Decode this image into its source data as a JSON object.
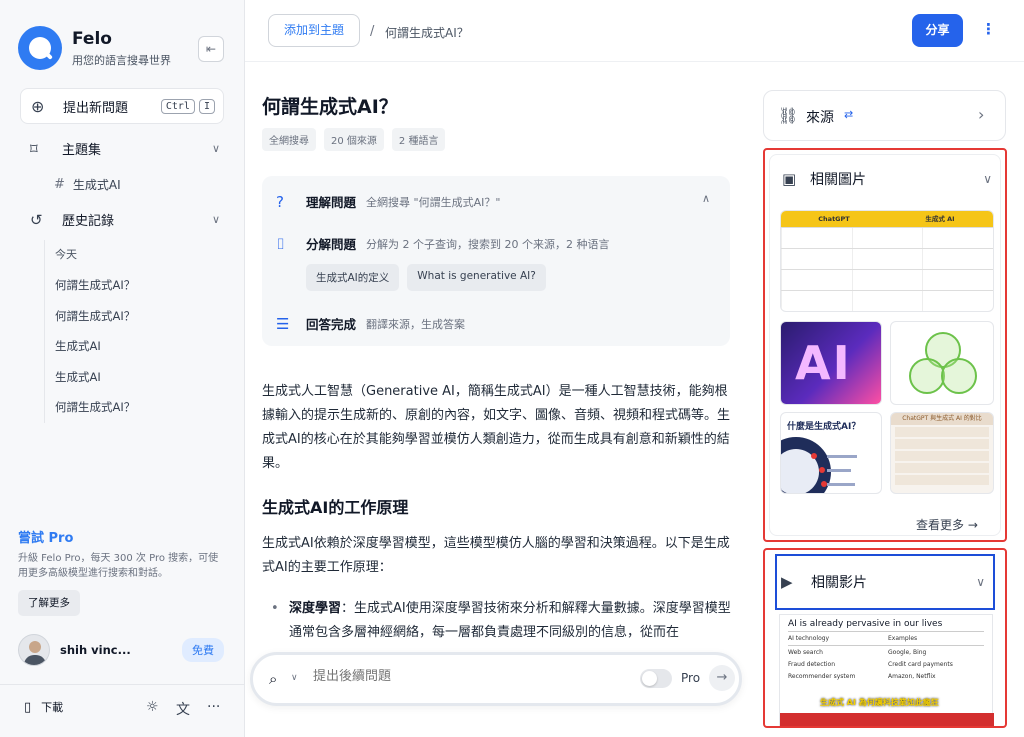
{
  "sidebar": {
    "brand_name": "Felo",
    "brand_sub": "用您的語言搜尋世界",
    "collapse_icon": "⇤",
    "new_question": {
      "label": "提出新問題",
      "kbd1": "Ctrl",
      "kbd2": "I"
    },
    "topics": {
      "label": "主題集",
      "item": "生成式AI"
    },
    "history": {
      "label": "歷史記錄",
      "group": "今天",
      "items": [
        "何謂生成式AI？",
        "何謂生成式AI？",
        "生成式AI",
        "生成式AI",
        "何謂生成式AI？"
      ]
    },
    "pro": {
      "title": "嘗試 Pro",
      "desc": "升級 Felo Pro，每天 300 次 Pro 搜索，可使用更多高級模型進行搜索和對話。",
      "learn_more": "了解更多"
    },
    "user": {
      "name": "shih vinc...",
      "badge": "免費"
    },
    "download": "下載"
  },
  "header": {
    "add_topic": "添加到主題",
    "separator": "/",
    "breadcrumb": "何謂生成式AI？",
    "share": "分享"
  },
  "main": {
    "title": "何謂生成式AI？",
    "tags": [
      "全網搜尋",
      "20 個來源",
      "2 種語言"
    ],
    "steps": [
      {
        "title": "理解問題",
        "desc": "全網搜尋 \"何謂生成式AI？\""
      },
      {
        "title": "分解問題",
        "desc": "分解为 2 个子查询，搜索到 20 个来源，2 种语言"
      },
      {
        "title": "回答完成",
        "desc": "翻譯來源，生成答案"
      }
    ],
    "chips": [
      "生成式AI的定义",
      "What is generative AI?"
    ],
    "intro": "生成式人工智慧（Generative AI，簡稱生成式AI）是一種人工智慧技術，能夠根據輸入的提示生成新的、原創的內容，如文字、圖像、音頻、視頻和程式碼等。生成式AI的核心在於其能夠學習並模仿人類創造力，從而生成具有創意和新穎性的結果。",
    "h2": "生成式AI的工作原理",
    "p2": "生成式AI依賴於深度學習模型，這些模型模仿人腦的學習和決策過程。以下是生成式AI的主要工作原理：",
    "bullet_bold": "深度學習",
    "bullet_text": "：生成式AI使用深度學習技術來分析和解釋大量數據。深度學習模型通常包含多層神經網絡，每一層都負責處理不同級別的信息，從而在",
    "search_placeholder": "提出後續問題",
    "pro_label": "Pro"
  },
  "right": {
    "sources_label": "來源",
    "images": {
      "label": "相關圖片",
      "see_more": "查看更多",
      "t1_headers": [
        "ChatGPT",
        "生成式 AI"
      ],
      "t2_text": "AI",
      "t4_title": "什麼是生成式AI？",
      "t5_header": "ChatGPT 與生成式 AI 的對比"
    },
    "videos": {
      "label": "相關影片",
      "vt_title": "AI is already pervasive in our lives",
      "vt_headers": [
        "AI technology",
        "Examples"
      ],
      "vt_rows": [
        [
          "Web search",
          "Google, Bing"
        ],
        [
          "Fraud detection",
          "Credit card payments"
        ],
        [
          "Recommender system",
          "Amazon, Netflix"
        ]
      ],
      "caption": "生成式 AI 為何讓科技業如此瘋狂"
    }
  },
  "colors": {
    "accent": "#2563eb",
    "highlight_red": "#e53935",
    "highlight_blue": "#1d4ed8"
  }
}
